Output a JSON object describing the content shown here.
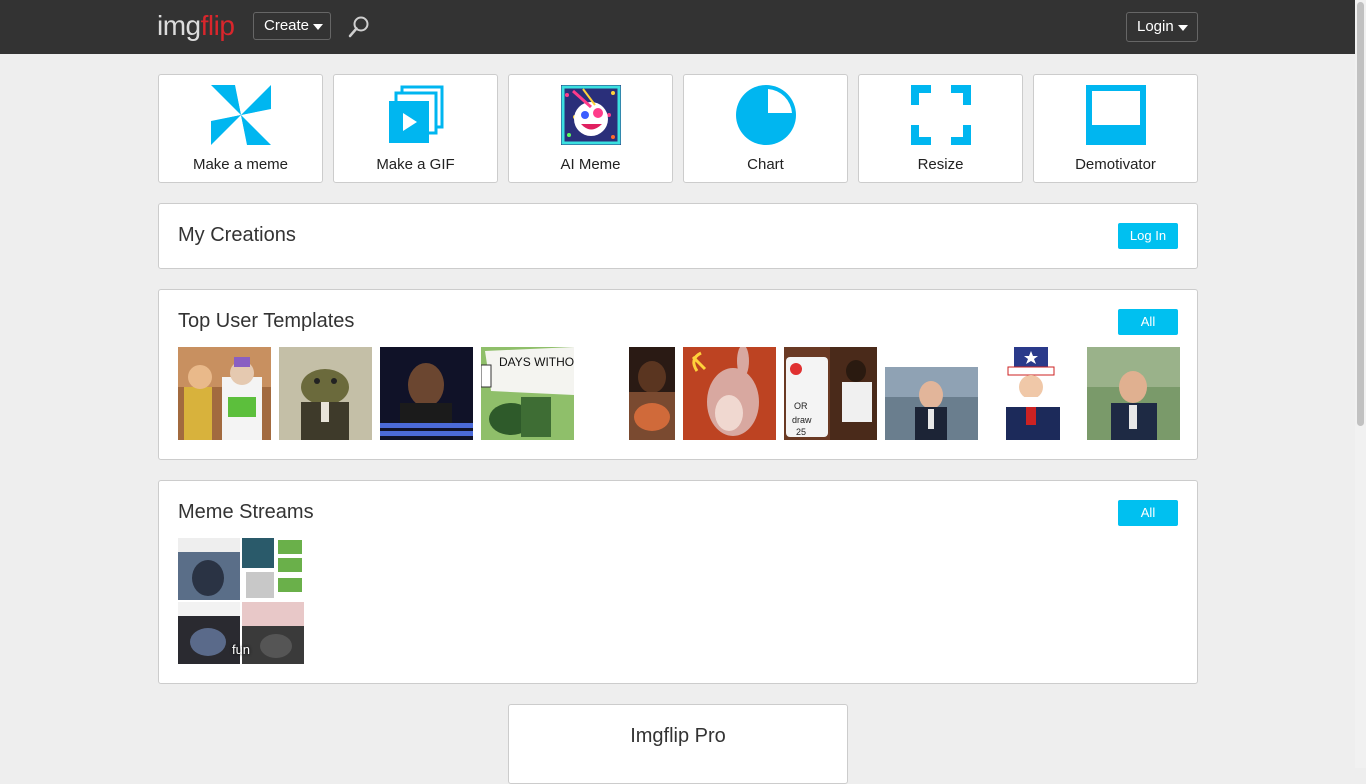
{
  "header": {
    "logo_img": "img",
    "logo_flip": "flip",
    "create_label": "Create",
    "login_label": "Login",
    "search_icon": "search-icon"
  },
  "tiles": [
    {
      "label": "Make a meme",
      "icon": "pinwheel-icon"
    },
    {
      "label": "Make a GIF",
      "icon": "gif-stack-icon"
    },
    {
      "label": "AI Meme",
      "icon": "ai-meme-icon"
    },
    {
      "label": "Chart",
      "icon": "pie-chart-icon"
    },
    {
      "label": "Resize",
      "icon": "resize-corners-icon"
    },
    {
      "label": "Demotivator",
      "icon": "demotivator-frame-icon"
    }
  ],
  "my_creations": {
    "title": "My Creations",
    "button": "Log In"
  },
  "top_templates": {
    "title": "Top User Templates",
    "button": "All",
    "thumbnail_texts": [
      "DAYS WITHO"
    ]
  },
  "meme_streams": {
    "title": "Meme Streams",
    "button": "All",
    "stream_label": "fun"
  },
  "pro": {
    "title": "Imgflip Pro"
  },
  "colors": {
    "accent": "#00c0f0",
    "topbar": "#333333",
    "logo_red": "#d9262c",
    "background": "#eeeeee"
  }
}
